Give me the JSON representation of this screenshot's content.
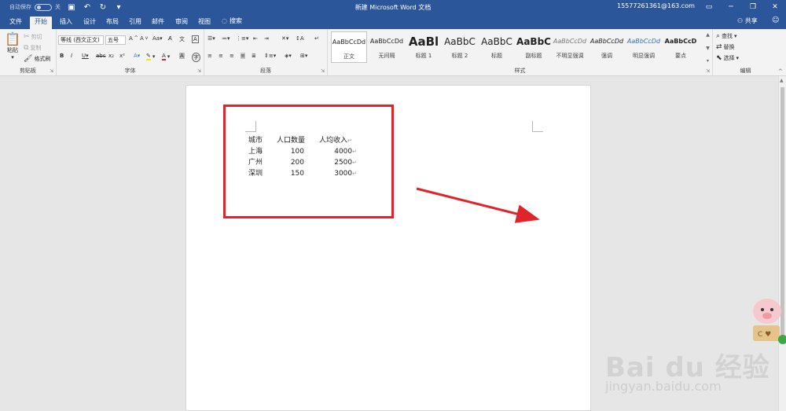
{
  "titlebar": {
    "autosave_label": "自动保存",
    "autosave_state": "关",
    "doc_title": "新建 Microsoft Word 文档",
    "account": "15577261361@163.com"
  },
  "tabs": [
    {
      "label": "文件"
    },
    {
      "label": "开始"
    },
    {
      "label": "插入"
    },
    {
      "label": "设计"
    },
    {
      "label": "布局"
    },
    {
      "label": "引用"
    },
    {
      "label": "邮件"
    },
    {
      "label": "审阅"
    },
    {
      "label": "视图"
    }
  ],
  "search_label": "搜索",
  "share_label": "共享",
  "ribbon": {
    "clipboard": {
      "paste": "粘贴",
      "cut": "剪切",
      "copy": "复制",
      "format_painter": "格式刷",
      "label": "剪贴板"
    },
    "font": {
      "font_name": "等线 (西文正文)",
      "font_size": "五号",
      "label": "字体"
    },
    "paragraph": {
      "label": "段落"
    },
    "styles": {
      "label": "样式",
      "items": [
        {
          "sample": "AaBbCcDd",
          "name": "正文"
        },
        {
          "sample": "AaBbCcDd",
          "name": "无间隔"
        },
        {
          "sample": "AaBl",
          "name": "标题 1"
        },
        {
          "sample": "AaBbC",
          "name": "标题 2"
        },
        {
          "sample": "AaBbC",
          "name": "标题"
        },
        {
          "sample": "AaBbC",
          "name": "副标题"
        },
        {
          "sample": "AaBbCcDd",
          "name": "不明显强调"
        },
        {
          "sample": "AaBbCcDd",
          "name": "强调"
        },
        {
          "sample": "AaBbCcDd",
          "name": "明显强调"
        },
        {
          "sample": "AaBbCcD",
          "name": "要点"
        }
      ]
    },
    "editing": {
      "find": "查找",
      "replace": "替换",
      "select": "选择",
      "label": "编辑"
    }
  },
  "document": {
    "headers": [
      "城市",
      "人口数量",
      "人均收入"
    ],
    "rows": [
      [
        "上海",
        "100",
        "4000"
      ],
      [
        "广州",
        "200",
        "2500"
      ],
      [
        "深圳",
        "150",
        "3000"
      ]
    ]
  },
  "watermark": {
    "brand": "Bai du 经验",
    "url": "jingyan.baidu.com"
  },
  "colors": {
    "titlebar": "#2b579a",
    "annotation": "#e0242a"
  }
}
